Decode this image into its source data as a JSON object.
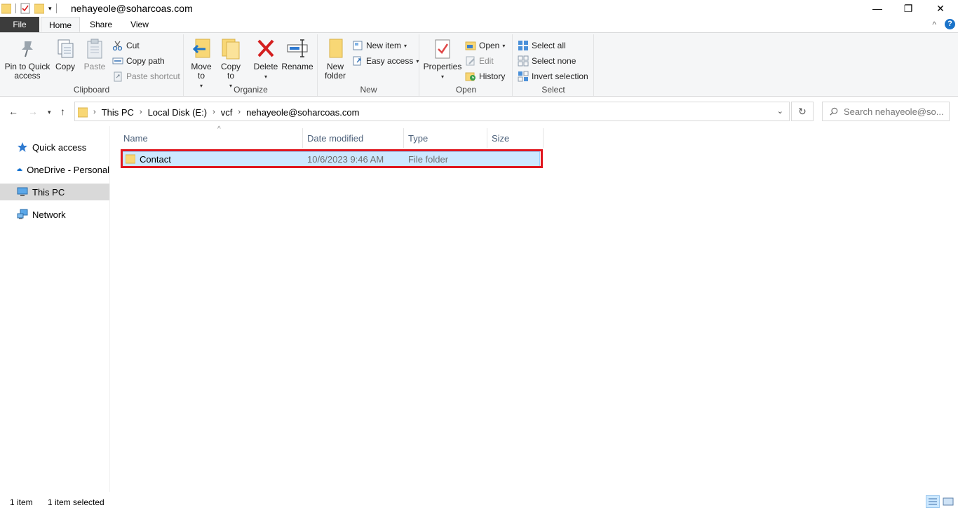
{
  "window": {
    "title": "nehayeole@soharcoas.com",
    "minimize": "—",
    "restore": "❐",
    "close": "✕"
  },
  "ribbon_tabs": [
    {
      "label": "File"
    },
    {
      "label": "Home"
    },
    {
      "label": "Share"
    },
    {
      "label": "View"
    }
  ],
  "help": {
    "collapse": "^",
    "help": "?"
  },
  "clipboard": {
    "pin": "Pin to Quick access",
    "copy": "Copy",
    "paste": "Paste",
    "cut": "Cut",
    "copy_path": "Copy path",
    "paste_shortcut": "Paste shortcut",
    "label": "Clipboard"
  },
  "organize": {
    "move_to": "Move to",
    "copy_to": "Copy to",
    "delete": "Delete",
    "rename": "Rename",
    "label": "Organize"
  },
  "new": {
    "new_folder": "New folder",
    "new_item": "New item",
    "easy_access": "Easy access",
    "label": "New"
  },
  "open": {
    "properties": "Properties",
    "open": "Open",
    "edit": "Edit",
    "history": "History",
    "label": "Open"
  },
  "select": {
    "select_all": "Select all",
    "select_none": "Select none",
    "invert": "Invert selection",
    "label": "Select"
  },
  "address": {
    "crumbs": [
      "This PC",
      "Local Disk (E:)",
      "vcf",
      "nehayeole@soharcoas.com"
    ],
    "search_placeholder": "Search nehayeole@so..."
  },
  "nav": [
    {
      "label": "Quick access"
    },
    {
      "label": "OneDrive - Personal"
    },
    {
      "label": "This PC"
    },
    {
      "label": "Network"
    }
  ],
  "columns": [
    "Name",
    "Date modified",
    "Type",
    "Size"
  ],
  "files": [
    {
      "name": "Contact",
      "date": "10/6/2023 9:46 AM",
      "type": "File folder",
      "size": ""
    }
  ],
  "status": {
    "count": "1 item",
    "selected": "1 item selected"
  },
  "colors": {
    "accent": "#1a73c9",
    "selection": "#cce8ff",
    "highlight_box": "#e0161e",
    "folder": "#f8d775"
  }
}
